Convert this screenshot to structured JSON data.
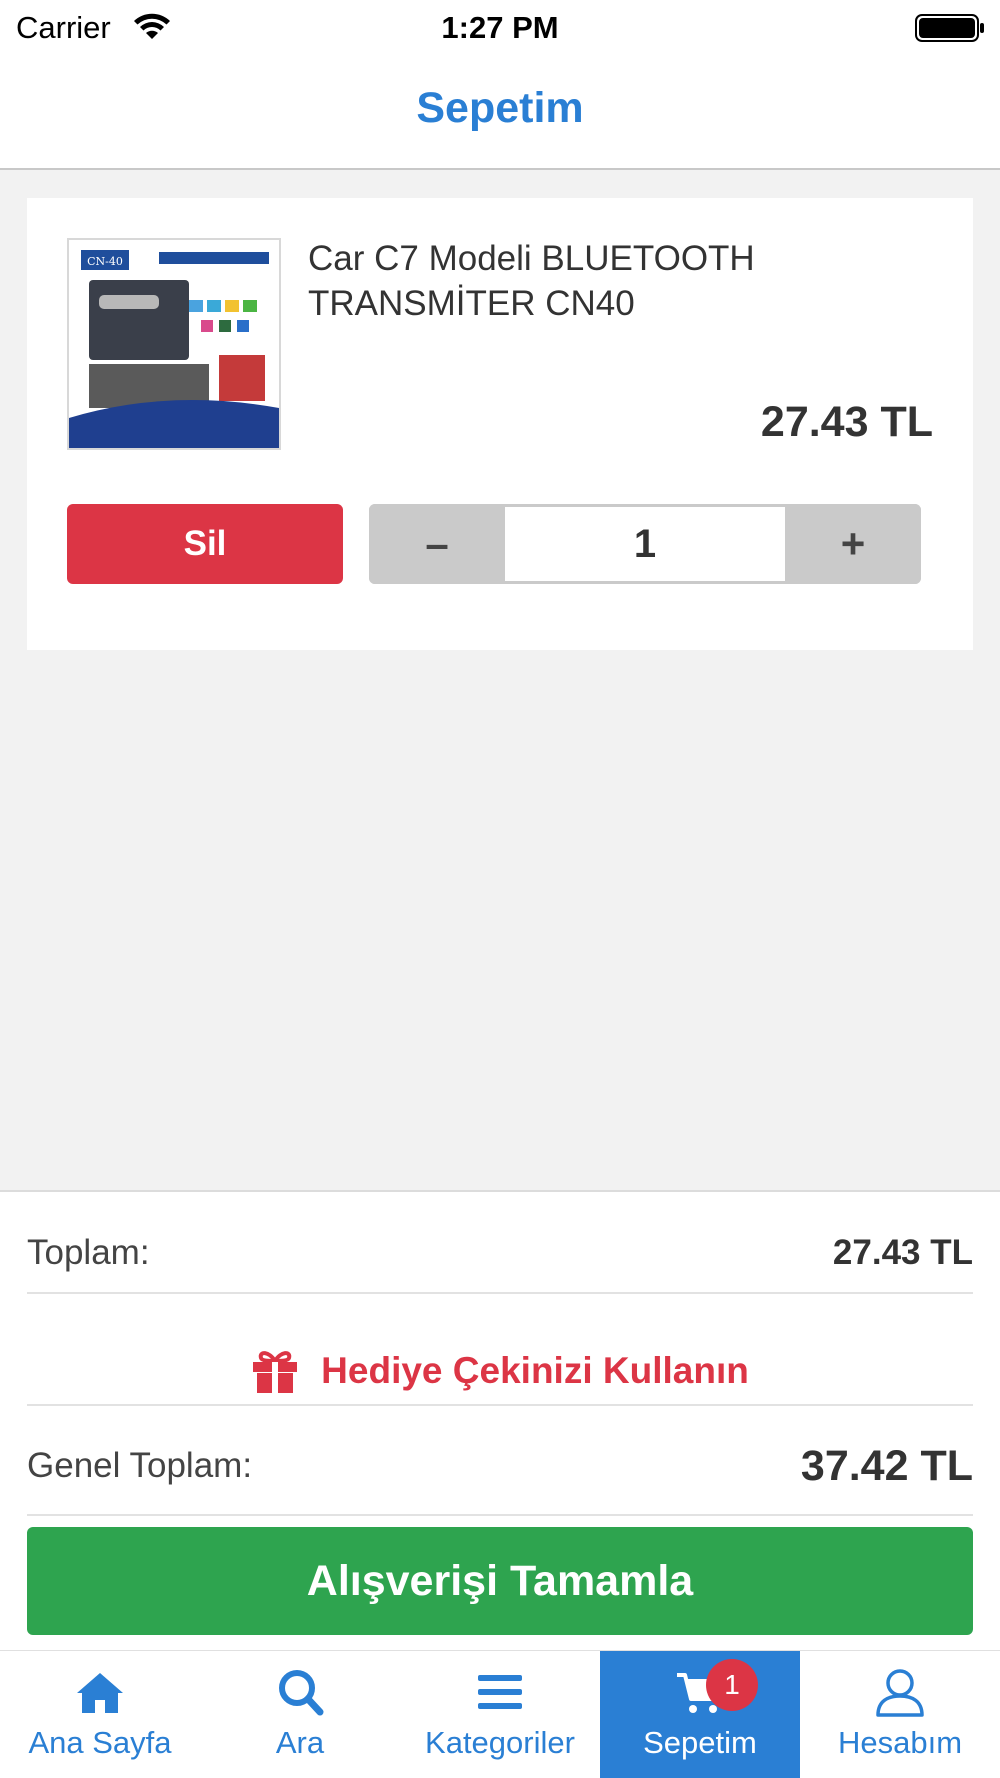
{
  "status_bar": {
    "carrier": "Carrier",
    "time": "1:27 PM"
  },
  "nav": {
    "title": "Sepetim"
  },
  "cart_item": {
    "name": "Car C7 Modeli BLUETOOTH TRANSMİTER CN40",
    "price": "27.43 TL",
    "delete_label": "Sil",
    "decrement_label": "–",
    "quantity": "1",
    "increment_label": "+",
    "image_label": "CN-40"
  },
  "summary": {
    "total_label": "Toplam:",
    "total_value": "27.43 TL",
    "gift_label": "Hediye Çekinizi Kullanın",
    "grand_total_label": "Genel Toplam:",
    "grand_total_value": "37.42 TL",
    "checkout_label": "Alışverişi Tamamla"
  },
  "tabs": [
    {
      "label": "Ana Sayfa",
      "icon": "home-icon"
    },
    {
      "label": "Ara",
      "icon": "search-icon"
    },
    {
      "label": "Kategoriler",
      "icon": "menu-icon"
    },
    {
      "label": "Sepetim",
      "icon": "cart-icon",
      "badge": "1",
      "active": true
    },
    {
      "label": "Hesabım",
      "icon": "user-icon"
    }
  ],
  "colors": {
    "accent": "#2a7fd4",
    "danger": "#dc3545",
    "success": "#2ea44f"
  }
}
